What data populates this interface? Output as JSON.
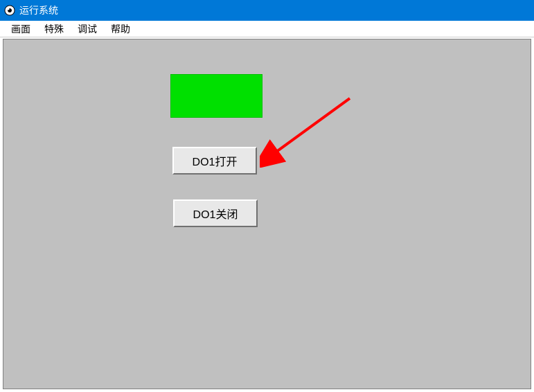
{
  "titlebar": {
    "title": "运行系统"
  },
  "menubar": {
    "items": [
      {
        "label": "画面"
      },
      {
        "label": "特殊"
      },
      {
        "label": "调试"
      },
      {
        "label": "帮助"
      }
    ]
  },
  "main": {
    "indicator_color": "#00e000",
    "button_open_label": "DO1打开",
    "button_close_label": "DO1关闭"
  },
  "annotation": {
    "arrow_color": "#ff0000"
  }
}
